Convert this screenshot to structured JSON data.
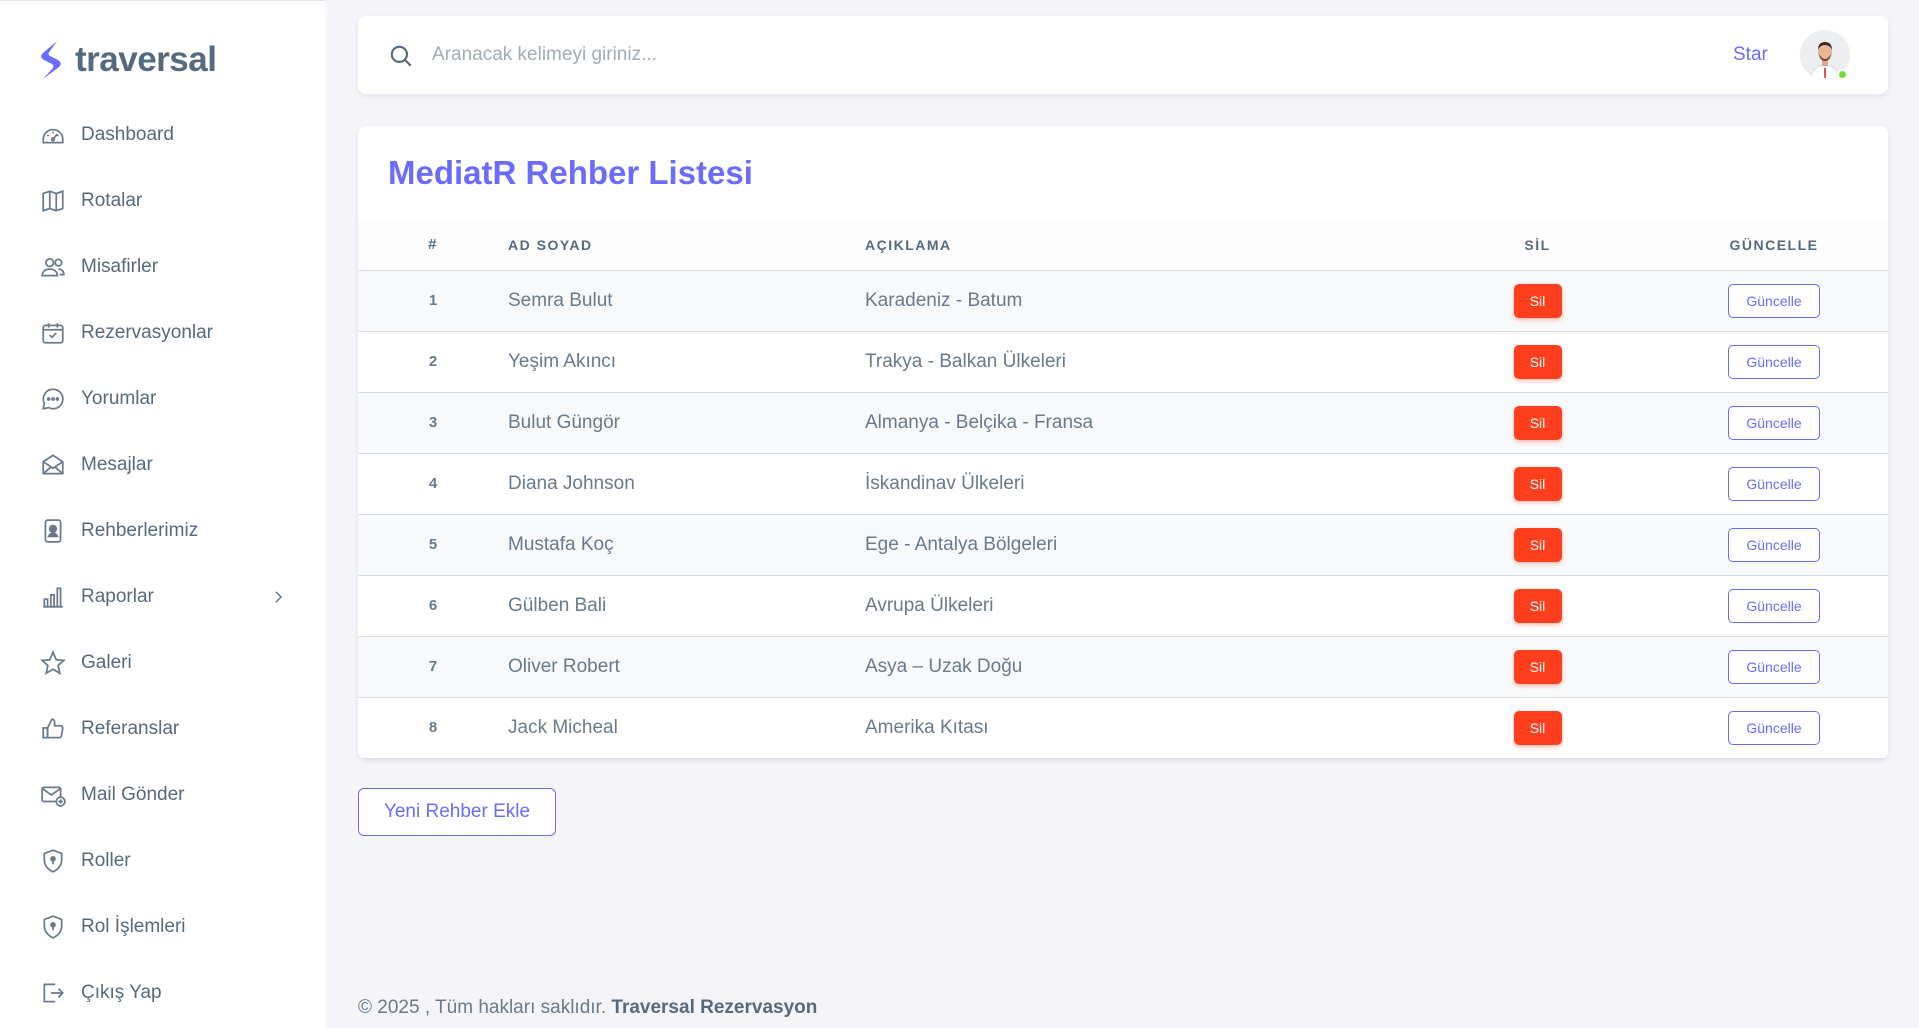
{
  "brand": {
    "name": "traversal"
  },
  "sidebar": {
    "items": [
      {
        "label": "Dashboard",
        "icon": "dashboard-icon"
      },
      {
        "label": "Rotalar",
        "icon": "map-icon"
      },
      {
        "label": "Misafirler",
        "icon": "users-icon"
      },
      {
        "label": "Rezervasyonlar",
        "icon": "calendar-icon"
      },
      {
        "label": "Yorumlar",
        "icon": "chat-icon"
      },
      {
        "label": "Mesajlar",
        "icon": "envelope-icon"
      },
      {
        "label": "Rehberlerimiz",
        "icon": "id-card-icon"
      },
      {
        "label": "Raporlar",
        "icon": "bar-chart-icon"
      },
      {
        "label": "Galeri",
        "icon": "star-icon"
      },
      {
        "label": "Referanslar",
        "icon": "thumbs-up-icon"
      },
      {
        "label": "Mail Gönder",
        "icon": "mail-send-icon"
      },
      {
        "label": "Roller",
        "icon": "shield-icon"
      },
      {
        "label": "Rol İşlemleri",
        "icon": "shield-icon"
      },
      {
        "label": "Çıkış Yap",
        "icon": "logout-icon"
      }
    ]
  },
  "topbar": {
    "search_placeholder": "Aranacak kelimeyi giriniz...",
    "user_label": "Star"
  },
  "card": {
    "title": "MediatR Rehber Listesi"
  },
  "table": {
    "headers": {
      "num": "#",
      "name": "AD SOYAD",
      "desc": "AÇIKLAMA",
      "delete": "SİL",
      "update": "GÜNCELLE"
    },
    "rows": [
      {
        "num": "1",
        "name": "Semra Bulut",
        "desc": "Karadeniz - Batum",
        "delete": "Sil",
        "update": "Güncelle"
      },
      {
        "num": "2",
        "name": "Yeşim Akıncı",
        "desc": "Trakya - Balkan Ülkeleri",
        "delete": "Sil",
        "update": "Güncelle"
      },
      {
        "num": "3",
        "name": "Bulut Güngör",
        "desc": "Almanya - Belçika - Fransa",
        "delete": "Sil",
        "update": "Güncelle"
      },
      {
        "num": "4",
        "name": "Diana Johnson",
        "desc": "İskandinav Ülkeleri",
        "delete": "Sil",
        "update": "Güncelle"
      },
      {
        "num": "5",
        "name": "Mustafa Koç",
        "desc": "Ege - Antalya Bölgeleri",
        "delete": "Sil",
        "update": "Güncelle"
      },
      {
        "num": "6",
        "name": "Gülben Bali",
        "desc": "Avrupa Ülkeleri",
        "delete": "Sil",
        "update": "Güncelle"
      },
      {
        "num": "7",
        "name": "Oliver Robert",
        "desc": "Asya – Uzak Doğu",
        "delete": "Sil",
        "update": "Güncelle"
      },
      {
        "num": "8",
        "name": "Jack Micheal",
        "desc": "Amerika Kıtası",
        "delete": "Sil",
        "update": "Güncelle"
      }
    ]
  },
  "actions": {
    "add_label": "Yeni Rehber Ekle"
  },
  "footer": {
    "text": "© 2025 , Tüm hakları saklıdır.",
    "company": "Traversal Rezervasyon"
  },
  "colors": {
    "accent": "#696cff",
    "danger": "#ff3e1d",
    "online": "#71dd37"
  }
}
